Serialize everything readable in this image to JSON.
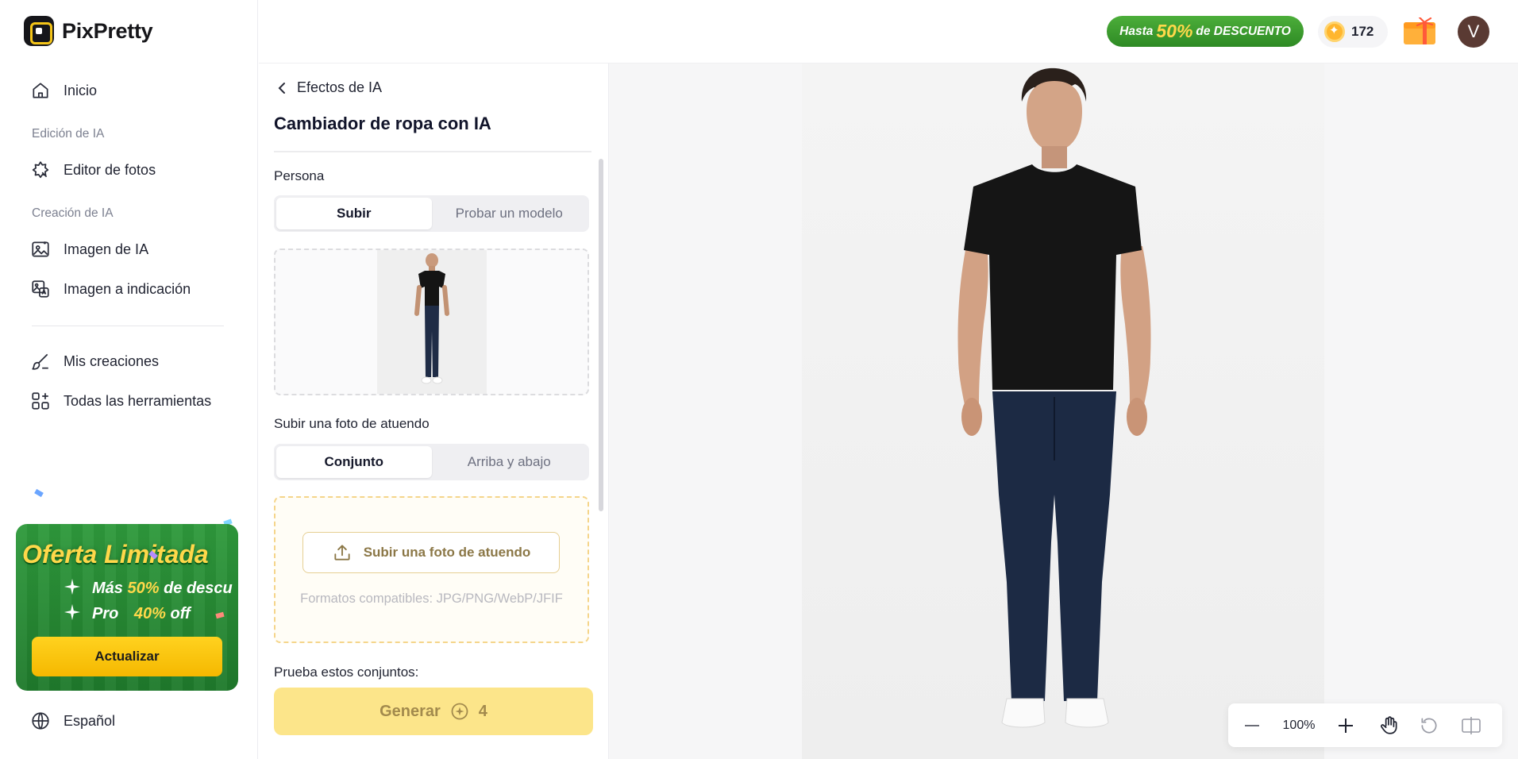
{
  "app": {
    "name": "PixPretty"
  },
  "sidebar": {
    "home": "Inicio",
    "section_edit": "Edición de IA",
    "photo_editor": "Editor de fotos",
    "section_create": "Creación de IA",
    "ai_image": "Imagen de IA",
    "image_to_prompt": "Imagen a indicación",
    "my_creations": "Mis creaciones",
    "all_tools": "Todas las herramientas",
    "language": "Español"
  },
  "promo": {
    "title": "Oferta Limitada",
    "line1_prefix": "Más",
    "line1_highlight": "50%",
    "line1_suffix": "de descu",
    "line2_prefix": "Pro",
    "line2_highlight": "40%",
    "line2_suffix": "off",
    "button": "Actualizar"
  },
  "topbar": {
    "deal_prefix": "Hasta",
    "deal_highlight": "50%",
    "deal_suffix": "de DESCUENTO",
    "credits": "172",
    "avatar_initial": "V"
  },
  "panel": {
    "back_label": "Efectos de IA",
    "title": "Cambiador de ropa con IA",
    "person_label": "Persona",
    "person_tabs": [
      "Subir",
      "Probar un modelo"
    ],
    "person_active": "Subir",
    "outfit_label": "Subir una foto de atuendo",
    "outfit_tabs": [
      "Conjunto",
      "Arriba y abajo"
    ],
    "outfit_active": "Conjunto",
    "upload_button": "Subir una foto de atuendo",
    "formats": "Formatos compatibles: JPG/PNG/WebP/JFIF",
    "try_label": "Prueba estos conjuntos:",
    "generate_label": "Generar",
    "generate_cost": "4"
  },
  "canvas": {
    "zoom": "100%"
  },
  "colors": {
    "accent_yellow": "#f5c518",
    "promo_green": "#2f9a3c",
    "generate_disabled": "#fce58a"
  },
  "icons": [
    "home-icon",
    "photo-editor-icon",
    "ai-image-icon",
    "image-to-prompt-icon",
    "brush-icon",
    "apps-icon",
    "globe-icon",
    "chevron-left-icon",
    "upload-icon",
    "coin-icon",
    "gift-icon",
    "zoom-out-icon",
    "zoom-in-icon",
    "hand-icon",
    "reset-icon",
    "compare-icon"
  ]
}
